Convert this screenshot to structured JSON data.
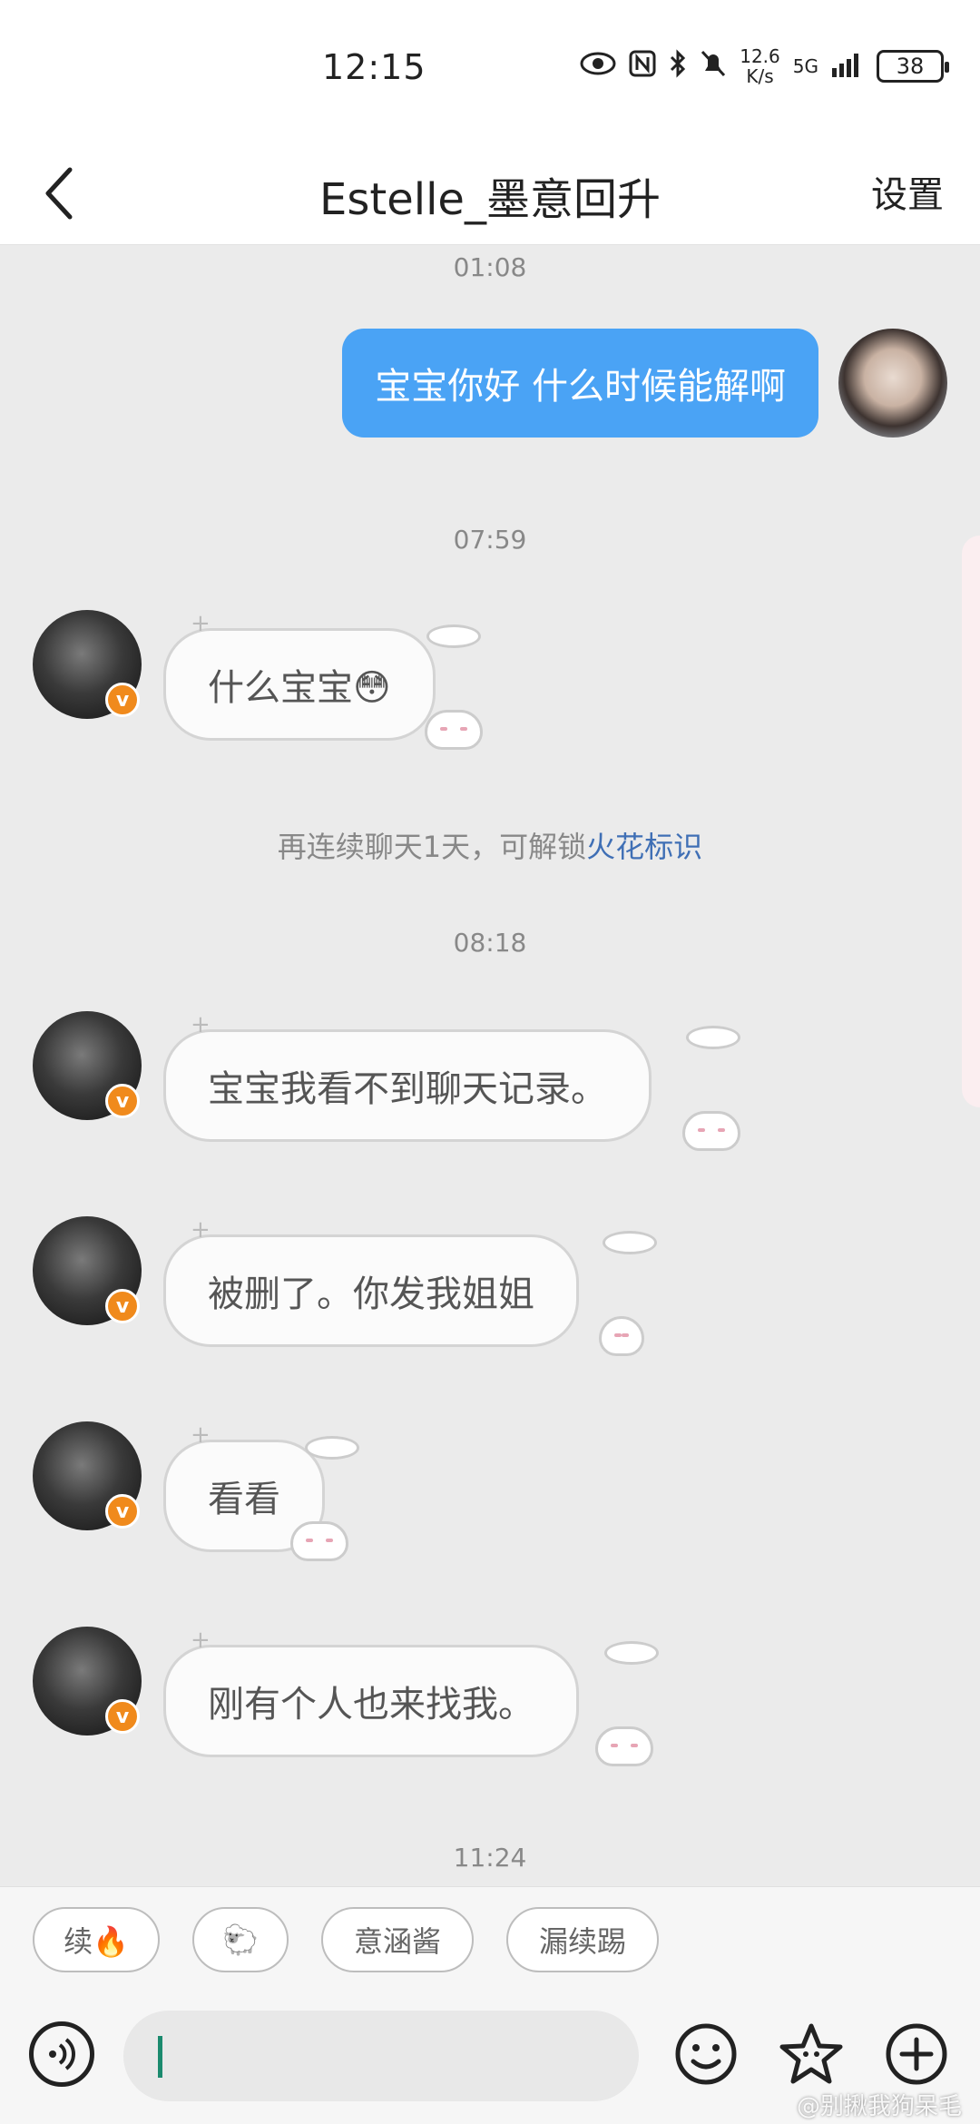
{
  "status_bar": {
    "time": "12:15",
    "net_speed_value": "12.6",
    "net_speed_unit": "K/s",
    "network": "5G",
    "battery": "38"
  },
  "header": {
    "title": "Estelle_墨意回升",
    "settings_label": "设置"
  },
  "messages": [
    {
      "time": "01:08",
      "from": "self",
      "text": "宝宝你好 什么时候能解啊"
    },
    {
      "time": "07:59",
      "from": "other",
      "text": "什么宝宝😳"
    },
    {
      "time": "08:18",
      "from": "other",
      "text": "宝宝我看不到聊天记录。"
    },
    {
      "from": "other",
      "text": "被删了。你发我姐姐"
    },
    {
      "from": "other",
      "text": "看看"
    },
    {
      "from": "other",
      "text": "刚有个人也来找我。"
    },
    {
      "time": "11:24"
    }
  ],
  "system_notice": {
    "prefix": "再连续聊天1天，可解锁",
    "link": "火花标识"
  },
  "verified_badge": "v",
  "quick_replies": [
    "续🔥",
    "🐑",
    "意涵酱",
    "漏续踢"
  ],
  "watermark": "@别揪我狗呆毛",
  "colors": {
    "outgoing_bubble": "#4aa3f5",
    "badge": "#f08a1c",
    "link": "#3f6fb5"
  }
}
